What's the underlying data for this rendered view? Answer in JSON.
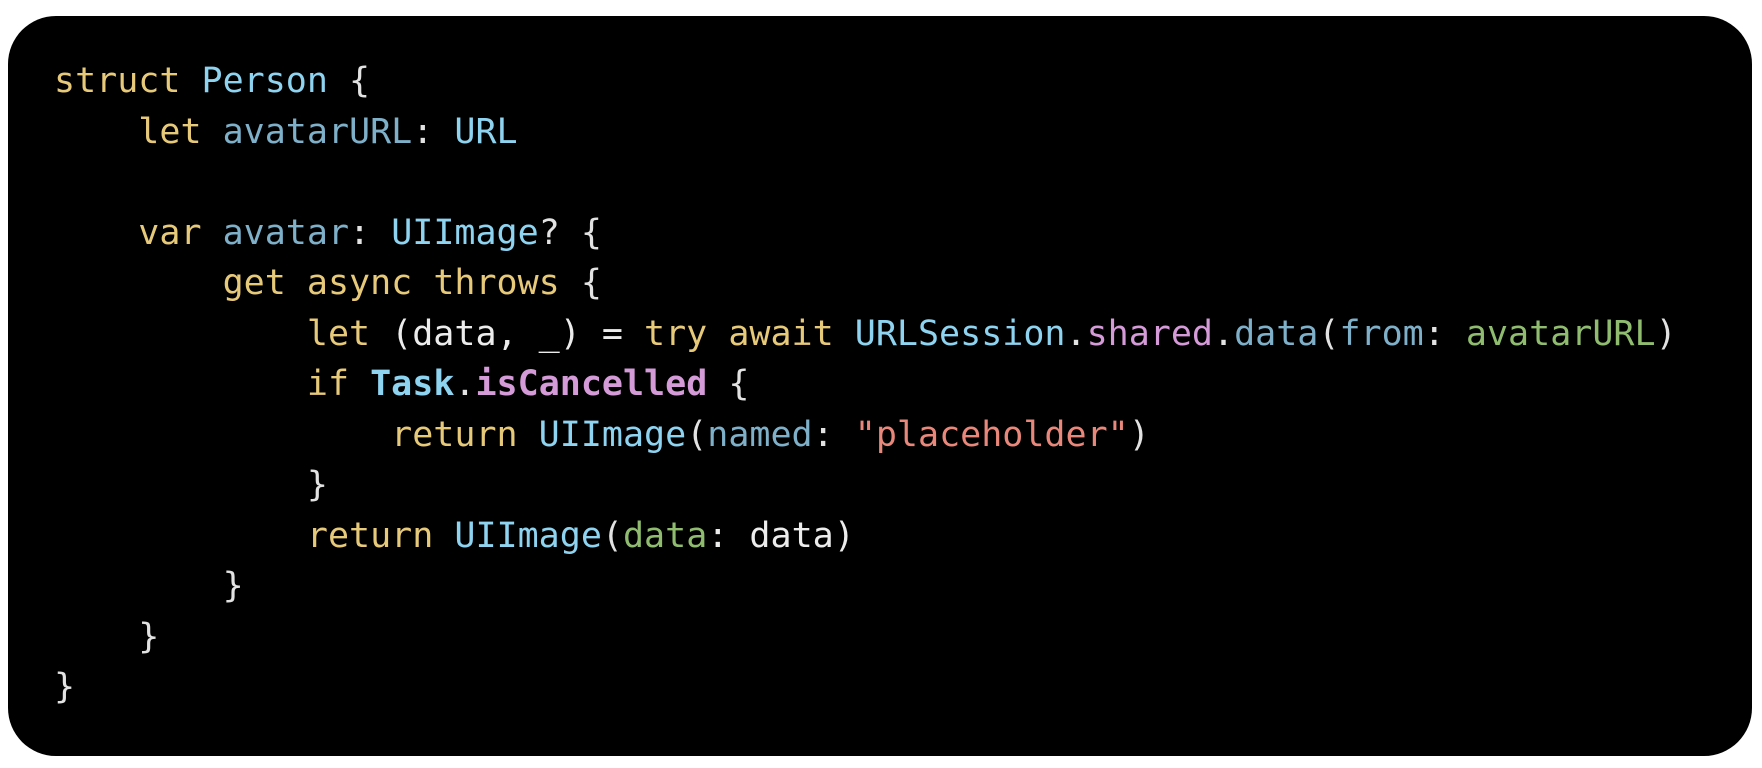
{
  "code": {
    "language": "swift",
    "lines": [
      [
        {
          "text": "struct",
          "cls": "kw"
        },
        {
          "text": " ",
          "cls": "plain"
        },
        {
          "text": "Person",
          "cls": "type"
        },
        {
          "text": " {",
          "cls": "punct"
        }
      ],
      [
        {
          "text": "    ",
          "cls": "plain"
        },
        {
          "text": "let",
          "cls": "kw"
        },
        {
          "text": " ",
          "cls": "plain"
        },
        {
          "text": "avatarURL",
          "cls": "prop"
        },
        {
          "text": ": ",
          "cls": "punct"
        },
        {
          "text": "URL",
          "cls": "type"
        }
      ],
      [],
      [
        {
          "text": "    ",
          "cls": "plain"
        },
        {
          "text": "var",
          "cls": "kw"
        },
        {
          "text": " ",
          "cls": "plain"
        },
        {
          "text": "avatar",
          "cls": "prop"
        },
        {
          "text": ": ",
          "cls": "punct"
        },
        {
          "text": "UIImage",
          "cls": "type"
        },
        {
          "text": "? {",
          "cls": "punct"
        }
      ],
      [
        {
          "text": "        ",
          "cls": "plain"
        },
        {
          "text": "get",
          "cls": "kw"
        },
        {
          "text": " ",
          "cls": "plain"
        },
        {
          "text": "async",
          "cls": "kw"
        },
        {
          "text": " ",
          "cls": "plain"
        },
        {
          "text": "throws",
          "cls": "kw"
        },
        {
          "text": " {",
          "cls": "punct"
        }
      ],
      [
        {
          "text": "            ",
          "cls": "plain"
        },
        {
          "text": "let",
          "cls": "kw"
        },
        {
          "text": " (data, _) = ",
          "cls": "plain"
        },
        {
          "text": "try",
          "cls": "kw"
        },
        {
          "text": " ",
          "cls": "plain"
        },
        {
          "text": "await",
          "cls": "kw"
        },
        {
          "text": " ",
          "cls": "plain"
        },
        {
          "text": "URLSession",
          "cls": "type"
        },
        {
          "text": ".",
          "cls": "punct"
        },
        {
          "text": "shared",
          "cls": "purple"
        },
        {
          "text": ".",
          "cls": "punct"
        },
        {
          "text": "data",
          "cls": "prop"
        },
        {
          "text": "(",
          "cls": "punct"
        },
        {
          "text": "from",
          "cls": "prop"
        },
        {
          "text": ": ",
          "cls": "punct"
        },
        {
          "text": "avatarURL",
          "cls": "param"
        },
        {
          "text": ")",
          "cls": "punct"
        }
      ],
      [
        {
          "text": "            ",
          "cls": "plain"
        },
        {
          "text": "if",
          "cls": "kw"
        },
        {
          "text": " ",
          "cls": "plain"
        },
        {
          "text": "Task",
          "cls": "type-bold"
        },
        {
          "text": ".",
          "cls": "punct"
        },
        {
          "text": "isCancelled",
          "cls": "purple-bold"
        },
        {
          "text": " {",
          "cls": "punct"
        }
      ],
      [
        {
          "text": "                ",
          "cls": "plain"
        },
        {
          "text": "return",
          "cls": "kw"
        },
        {
          "text": " ",
          "cls": "plain"
        },
        {
          "text": "UIImage",
          "cls": "type"
        },
        {
          "text": "(",
          "cls": "punct"
        },
        {
          "text": "named",
          "cls": "prop"
        },
        {
          "text": ": ",
          "cls": "punct"
        },
        {
          "text": "\"placeholder\"",
          "cls": "str"
        },
        {
          "text": ")",
          "cls": "punct"
        }
      ],
      [
        {
          "text": "            }",
          "cls": "punct"
        }
      ],
      [
        {
          "text": "            ",
          "cls": "plain"
        },
        {
          "text": "return",
          "cls": "kw"
        },
        {
          "text": " ",
          "cls": "plain"
        },
        {
          "text": "UIImage",
          "cls": "type"
        },
        {
          "text": "(",
          "cls": "punct"
        },
        {
          "text": "data",
          "cls": "param"
        },
        {
          "text": ": data)",
          "cls": "plain"
        }
      ],
      [
        {
          "text": "        }",
          "cls": "punct"
        }
      ],
      [
        {
          "text": "    }",
          "cls": "punct"
        }
      ],
      [
        {
          "text": "}",
          "cls": "punct"
        }
      ]
    ]
  },
  "colors": {
    "card_background": "#000000",
    "page_background": "#ffffff",
    "keyword": "#e7c97a",
    "type": "#8ed3f0",
    "property": "#7fb0c9",
    "parameter": "#8fbc6e",
    "member": "#d59ad8",
    "string": "#e8877a",
    "plain": "#ececec"
  }
}
